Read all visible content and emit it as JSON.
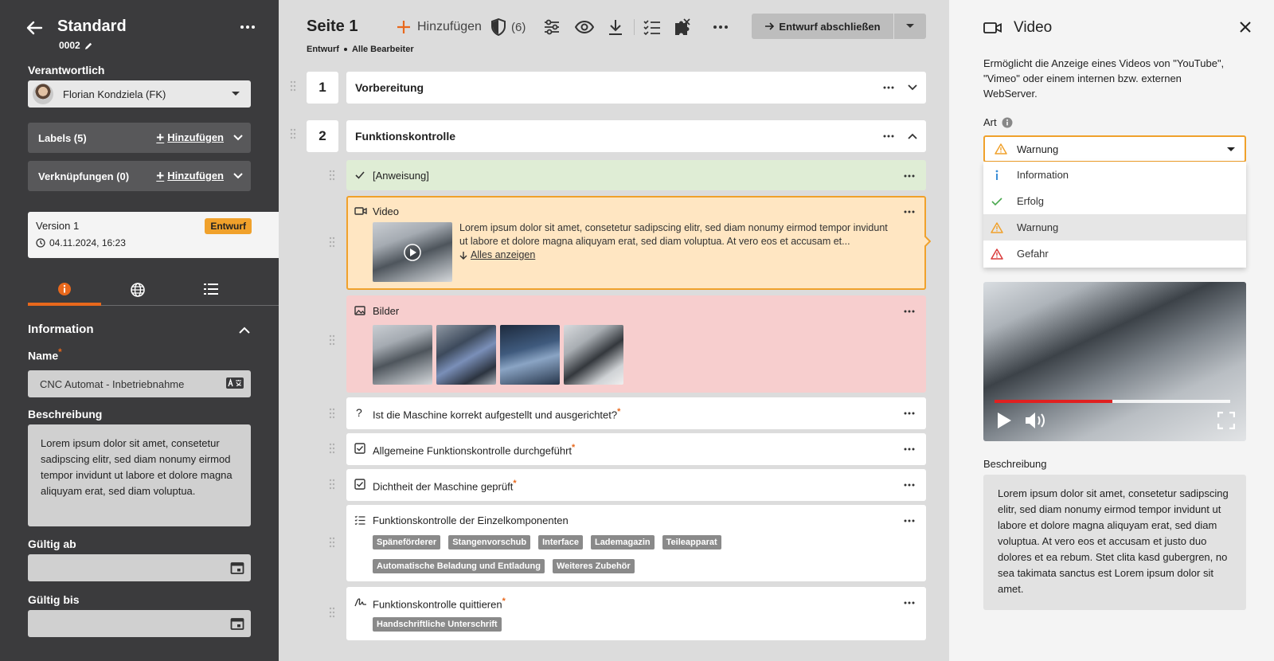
{
  "left": {
    "title": "Standard",
    "code": "0002",
    "responsible_label": "Verantwortlich",
    "responsible_value": "Florian Kondziela (FK)",
    "labels": {
      "label": "Labels (5)",
      "add": "Hinzufügen"
    },
    "links": {
      "label": "Verknüpfungen (0)",
      "add": "Hinzufügen"
    },
    "version": {
      "title": "Version 1",
      "date": "04.11.2024, 16:23",
      "badge": "Entwurf"
    },
    "section_title": "Information",
    "name_label": "Name",
    "name_required": "*",
    "name_value": "CNC Automat - Inbetriebnahme",
    "desc_label": "Beschreibung",
    "desc_value": "Lorem ipsum dolor sit amet, consetetur sadipscing elitr, sed diam nonumy eirmod tempor invidunt ut labore et dolore magna aliquyam erat, sed diam voluptua.",
    "valid_from_label": "Gültig ab",
    "valid_to_label": "Gültig bis"
  },
  "main": {
    "title": "Seite 1",
    "status": "Entwurf",
    "editors": "Alle Bearbeiter",
    "toolbar": {
      "add": "Hinzufügen",
      "count": "(6)",
      "finish": "Entwurf abschließen"
    },
    "sections": [
      {
        "num": "1",
        "title": "Vorbereitung"
      },
      {
        "num": "2",
        "title": "Funktionskontrolle"
      }
    ],
    "items": {
      "instruction": "[Anweisung]",
      "video_title": "Video",
      "video_text": "Lorem ipsum dolor sit amet, consetetur sadipscing elitr, sed diam nonumy eirmod tempor invidunt ut labore et dolore magna aliquyam erat, sed diam voluptua. At vero eos et accusam et...",
      "video_more": "Alles anzeigen",
      "images_title": "Bilder",
      "q1": "Ist die Maschine korrekt aufgestellt und ausgerichtet?",
      "c1": "Allgemeine Funktionskontrolle durchgeführt",
      "c2": "Dichtheit der Maschine geprüft",
      "list_title": "Funktionskontrolle der Einzelkomponenten",
      "tags_row1": [
        "Späneförderer",
        "Stangenvorschub",
        "Interface",
        "Lademagazin",
        "Teileapparat"
      ],
      "tags_row2": [
        "Automatische Beladung und Entladung",
        "Weiteres Zubehör"
      ],
      "sign_title": "Funktionskontrolle quittieren",
      "sign_tag": "Handschriftliche Unterschrift",
      "required": "*"
    }
  },
  "right": {
    "title": "Video",
    "description": "Ermöglicht die Anzeige eines Videos von \"YouTube\", \"Vimeo\" oder einem internen bzw. externen WebServer.",
    "type_label": "Art",
    "type_value": "Warnung",
    "options": [
      "Information",
      "Erfolg",
      "Warnung",
      "Gefahr"
    ],
    "video_progress": 0.5,
    "desc_label": "Beschreibung",
    "desc_value": "Lorem ipsum dolor sit amet, consetetur sadipscing elitr, sed diam nonumy eirmod tempor invidunt ut labore et dolore magna aliquyam erat, sed diam voluptua. At vero eos et accusam et justo duo dolores et ea rebum. Stet clita kasd gubergren, no sea takimata sanctus est Lorem ipsum dolor sit amet."
  },
  "colors": {
    "accent": "#e8681c",
    "warning": "#f0a12b",
    "instruction_bg": "#dfedd5",
    "video_bg": "#ffe6c2",
    "images_bg": "#f7cece",
    "info_blue": "#3b8ed6",
    "success_green": "#49a84e",
    "danger_red": "#d93a3a"
  }
}
